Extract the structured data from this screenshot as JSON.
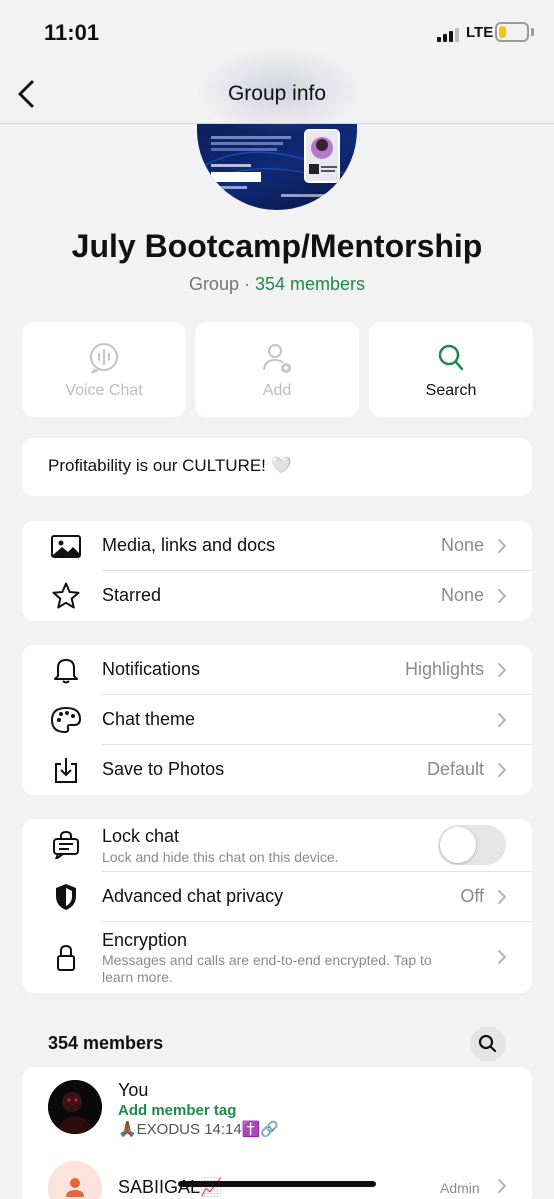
{
  "status_bar": {
    "time": "11:01",
    "network": "LTE",
    "battery_level": 0.25
  },
  "header": {
    "title": "Group info"
  },
  "group": {
    "name": "July Bootcamp/Mentorship",
    "type_label": "Group",
    "separator": "·",
    "member_count_label": "354 members"
  },
  "actions": [
    {
      "label": "Voice Chat",
      "icon": "voice-chat-icon",
      "enabled": false
    },
    {
      "label": "Add",
      "icon": "add-person-icon",
      "enabled": false
    },
    {
      "label": "Search",
      "icon": "search-icon",
      "enabled": true
    }
  ],
  "description": {
    "text": "Profitability is our CULTURE! 🤍"
  },
  "section_media": [
    {
      "label": "Media, links and docs",
      "value": "None",
      "icon": "image-icon"
    },
    {
      "label": "Starred",
      "value": "None",
      "icon": "star-icon"
    }
  ],
  "section_settings": [
    {
      "label": "Notifications",
      "value": "Highlights",
      "icon": "bell-icon"
    },
    {
      "label": "Chat theme",
      "value": "",
      "icon": "palette-icon"
    },
    {
      "label": "Save to Photos",
      "value": "Default",
      "icon": "download-icon"
    }
  ],
  "section_privacy": {
    "lock_chat": {
      "label": "Lock chat",
      "sublabel": "Lock and hide this chat on this device.",
      "enabled": false,
      "icon": "lock-chat-icon"
    },
    "advanced_privacy": {
      "label": "Advanced chat privacy",
      "value": "Off",
      "icon": "shield-icon"
    },
    "encryption": {
      "label": "Encryption",
      "sublabel_line1": "Messages and calls are end-to-end encrypted. Tap to",
      "sublabel_line2": "learn more.",
      "icon": "padlock-icon"
    }
  },
  "members": {
    "title": "354 members",
    "list": [
      {
        "name": "You",
        "tag": "Add member tag",
        "status": "🙏🏾EXODUS 14:14✝️🔗"
      },
      {
        "name": "SABIIGAL📈",
        "role": "Admin"
      }
    ]
  },
  "colors": {
    "accent_green": "#1f8a4c",
    "background": "#f2f2f2"
  }
}
